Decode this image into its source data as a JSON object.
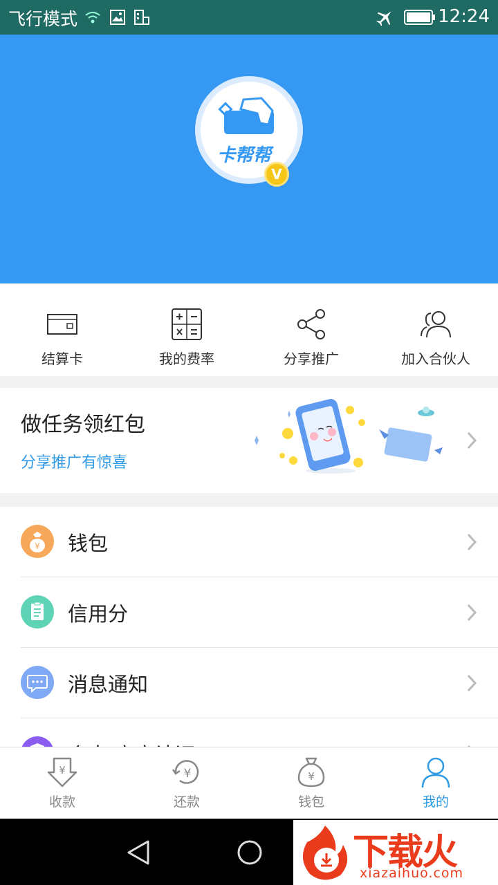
{
  "status_bar": {
    "carrier": "飞行模式",
    "time": "12:24"
  },
  "header": {
    "logo_text": "卡帮帮",
    "badge": "V"
  },
  "quick_actions": [
    {
      "label": "结算卡",
      "icon": "card-icon"
    },
    {
      "label": "我的费率",
      "icon": "calculator-icon"
    },
    {
      "label": "分享推广",
      "icon": "share-icon"
    },
    {
      "label": "加入合伙人",
      "icon": "partner-icon"
    }
  ],
  "task_banner": {
    "title": "做任务领红包",
    "subtitle": "分享推广有惊喜"
  },
  "menu": [
    {
      "label": "钱包",
      "icon": "money-bag-icon",
      "color": "#f7a85a"
    },
    {
      "label": "信用分",
      "icon": "clipboard-icon",
      "color": "#5fd3b5"
    },
    {
      "label": "消息通知",
      "icon": "chat-icon",
      "color": "#7fa8f5"
    },
    {
      "label": "个人/商户认证",
      "icon": "shield-icon",
      "color": "#8a5cf0"
    }
  ],
  "tabs": [
    {
      "label": "收款",
      "icon": "receive-icon",
      "active": false
    },
    {
      "label": "还款",
      "icon": "repay-icon",
      "active": false
    },
    {
      "label": "钱包",
      "icon": "wallet-bag-icon",
      "active": false
    },
    {
      "label": "我的",
      "icon": "person-icon",
      "active": true
    }
  ],
  "watermark": {
    "text": "下载火",
    "sub": "xiazaihuo.com"
  },
  "colors": {
    "primary": "#3598f3",
    "accent": "#2f9ae6",
    "status_bar": "#1f6b63"
  }
}
